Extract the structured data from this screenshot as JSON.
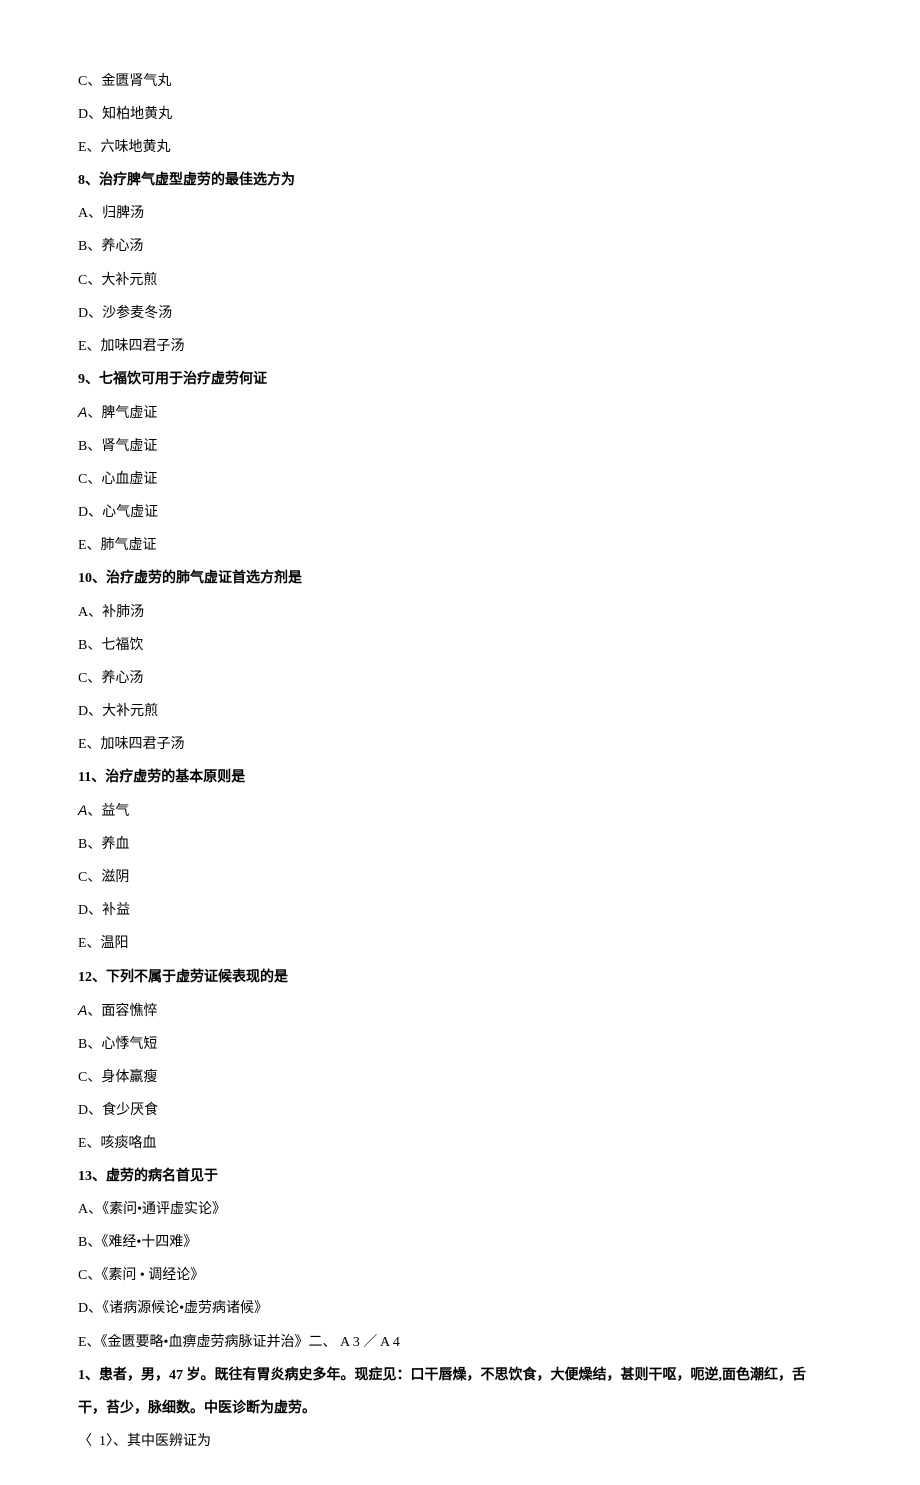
{
  "lines": [
    {
      "text": "C、金匮肾气丸",
      "bold": false
    },
    {
      "text": "D、知柏地黄丸",
      "bold": false
    },
    {
      "text": "E、六味地黄丸",
      "bold": false
    },
    {
      "text": "8、治疗脾气虚型虚劳的最佳选方为",
      "bold": true
    },
    {
      "text": "A、归脾汤",
      "bold": false
    },
    {
      "text": "B、养心汤",
      "bold": false
    },
    {
      "text": "C、大补元煎",
      "bold": false
    },
    {
      "text": "D、沙参麦冬汤",
      "bold": false
    },
    {
      "text": "E、加味四君子汤",
      "bold": false
    },
    {
      "text": "9、七福饮可用于治疗虚劳何证",
      "bold": true
    },
    {
      "prefix": "A",
      "text": "、脾气虚证",
      "bold": false,
      "italPrefix": true
    },
    {
      "text": "B、肾气虚证",
      "bold": false
    },
    {
      "text": "C、心血虚证",
      "bold": false
    },
    {
      "text": "D、心气虚证",
      "bold": false
    },
    {
      "text": "E、肺气虚证",
      "bold": false
    },
    {
      "text": "10、治疗虚劳的肺气虚证首选方剂是",
      "bold": true
    },
    {
      "text": "A、补肺汤",
      "bold": false
    },
    {
      "text": "B、七福饮",
      "bold": false
    },
    {
      "text": "C、养心汤",
      "bold": false
    },
    {
      "text": "D、大补元煎",
      "bold": false
    },
    {
      "text": "E、加味四君子汤",
      "bold": false
    },
    {
      "text": "11、治疗虚劳的基本原则是",
      "bold": true
    },
    {
      "prefix": "A",
      "text": "、益气",
      "bold": false,
      "italPrefix": true
    },
    {
      "text": "B、养血",
      "bold": false
    },
    {
      "text": "C、滋阴",
      "bold": false
    },
    {
      "text": "D、补益",
      "bold": false
    },
    {
      "text": "E、温阳",
      "bold": false
    },
    {
      "text": "12、下列不属于虚劳证候表现的是",
      "bold": true
    },
    {
      "prefix": "A",
      "text": "、面容憔悴",
      "bold": false,
      "italPrefix": true
    },
    {
      "text": "B、心悸气短",
      "bold": false
    },
    {
      "text": "C、身体羸瘦",
      "bold": false
    },
    {
      "text": "D、食少厌食",
      "bold": false
    },
    {
      "text": "E、咳痰咯血",
      "bold": false
    },
    {
      "text": "13、虚劳的病名首见于",
      "bold": true
    },
    {
      "text": "A、《素问•通评虚实论》",
      "bold": false
    },
    {
      "text": "B、《难经•十四难》",
      "bold": false
    },
    {
      "text": "C、《素问 • 调经论》",
      "bold": false
    },
    {
      "text": "D、《诸病源候论•虚劳病诸候》",
      "bold": false
    },
    {
      "text": "E、《金匮要略•血痹虚劳病脉证并治》二、 A 3 ／ A 4",
      "bold": false
    },
    {
      "text": "1、患者，男，47 岁。既往有胃炎病史多年。现症见：口干唇燥，不思饮食，大便燥结，甚则干呕，呃逆,面色潮红，舌",
      "bold": true
    },
    {
      "text": "干，苔少，脉细数。中医诊断为虚劳。",
      "bold": true
    },
    {
      "text": "〈  1〉、其中医辨证为",
      "bold": false
    }
  ]
}
